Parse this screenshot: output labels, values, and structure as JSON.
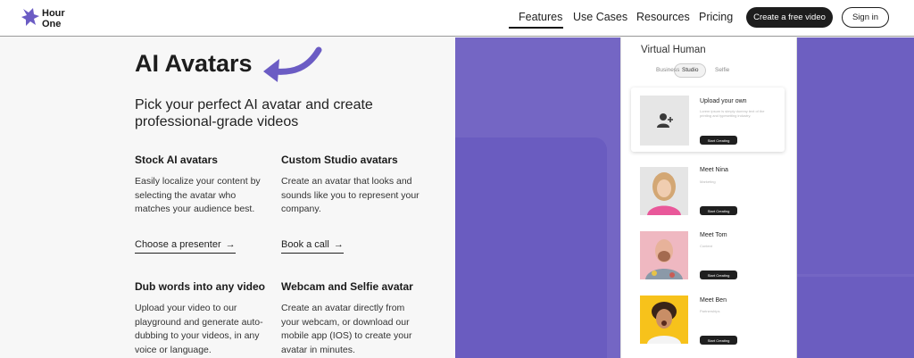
{
  "header": {
    "logo_line1": "Hour",
    "logo_line2": "One",
    "nav": [
      "Features",
      "Use Cases",
      "Resources",
      "Pricing"
    ],
    "cta_label": "Create a free video",
    "signin_label": "Sign in"
  },
  "hero": {
    "title": "AI Avatars",
    "subtitle": "Pick your perfect AI avatar and create professional-grade videos"
  },
  "features": [
    {
      "heading": "Stock AI avatars",
      "body": "Easily localize your content by selecting the avatar who matches your audience best.",
      "link": "Choose a presenter"
    },
    {
      "heading": "Custom Studio avatars",
      "body": "Create an avatar that looks and sounds like you to represent your company.",
      "link": "Book a call"
    },
    {
      "heading": "Dub words into any video",
      "body": "Upload your video to our playground and generate auto-dubbing to your videos, in any voice or language."
    },
    {
      "heading": "Webcam and Selfie avatar",
      "body": "Create an avatar directly from your webcam, or download our mobile app (IOS) to create your avatar in minutes."
    }
  ],
  "panel": {
    "title": "Virtual Human",
    "tabs": [
      "Business",
      "Studio",
      "Selfie"
    ],
    "upload": {
      "name": "Upload your own",
      "desc": "Lorem ipsum is simply dummy text of the printing and typesetting industry.",
      "button": "Start Creating"
    },
    "avatars": [
      {
        "name": "Meet Nina",
        "role": "Marketing",
        "button": "Start Creating"
      },
      {
        "name": "Meet Tom",
        "role": "Content",
        "button": "Start Creating"
      },
      {
        "name": "Meet Ben",
        "role": "Partnerships",
        "button": "Start Creating"
      }
    ]
  },
  "colors": {
    "accent_purple": "#7466c4",
    "dark_button": "#1d1d1d",
    "arrow": "#6b5cc4"
  },
  "icons": [
    "hourone-logo-icon",
    "curved-arrow-icon",
    "arrow-right-icon",
    "add-user-icon"
  ]
}
